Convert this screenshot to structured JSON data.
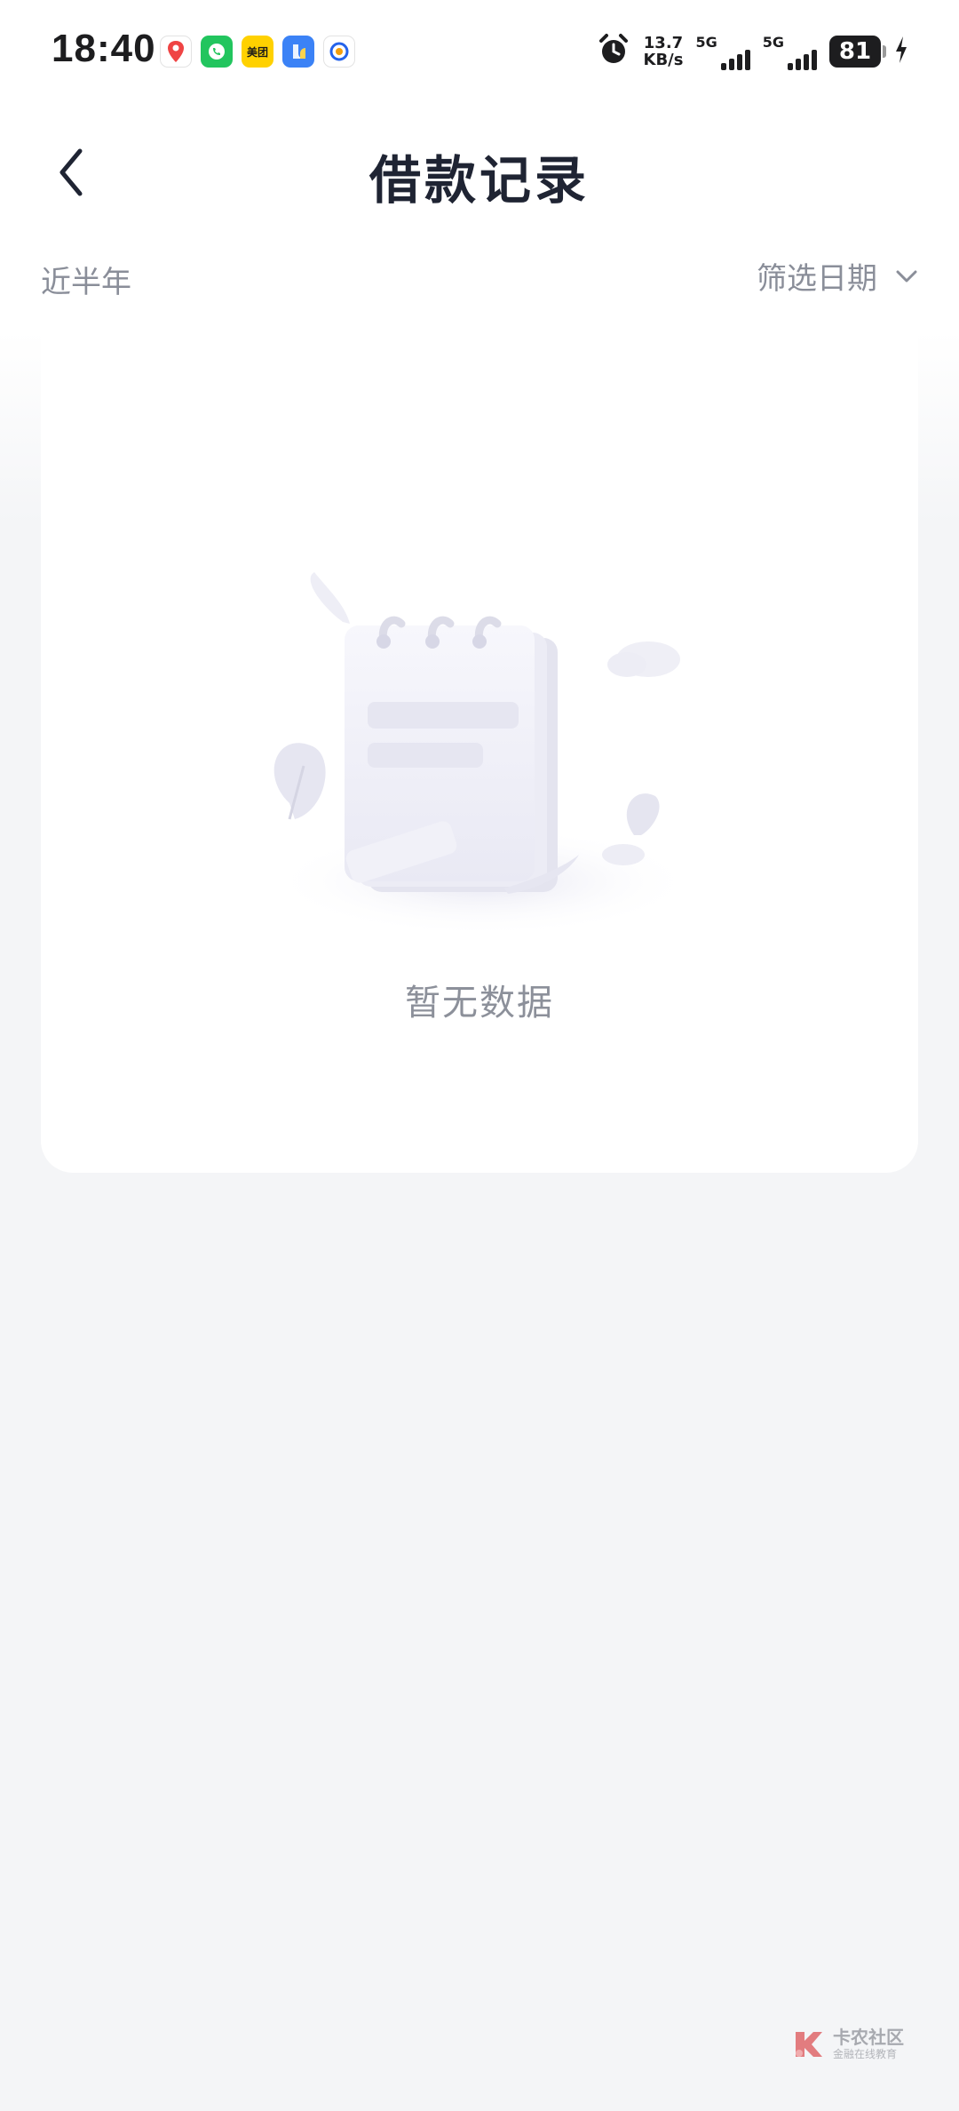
{
  "status_bar": {
    "time": "18:40",
    "network_speed_value": "13.7",
    "network_speed_unit": "KB/s",
    "sim1_label": "5G",
    "sim2_label": "5G",
    "battery_level": "81",
    "app_icons": [
      "map-icon",
      "phone-icon",
      "meituan-icon",
      "blue-app-icon",
      "qq-browser-icon"
    ],
    "meituan_label": "美团"
  },
  "nav": {
    "title": "借款记录"
  },
  "filter": {
    "range_label": "近半年",
    "date_filter_label": "筛选日期"
  },
  "empty_state": {
    "message": "暂无数据"
  },
  "watermark": {
    "title": "卡农社区",
    "subtitle": "金融在线教育"
  },
  "colors": {
    "title": "#1f2433",
    "secondary_text": "#8a8e99",
    "page_background": "#f4f5f7",
    "card_background": "#ffffff"
  }
}
